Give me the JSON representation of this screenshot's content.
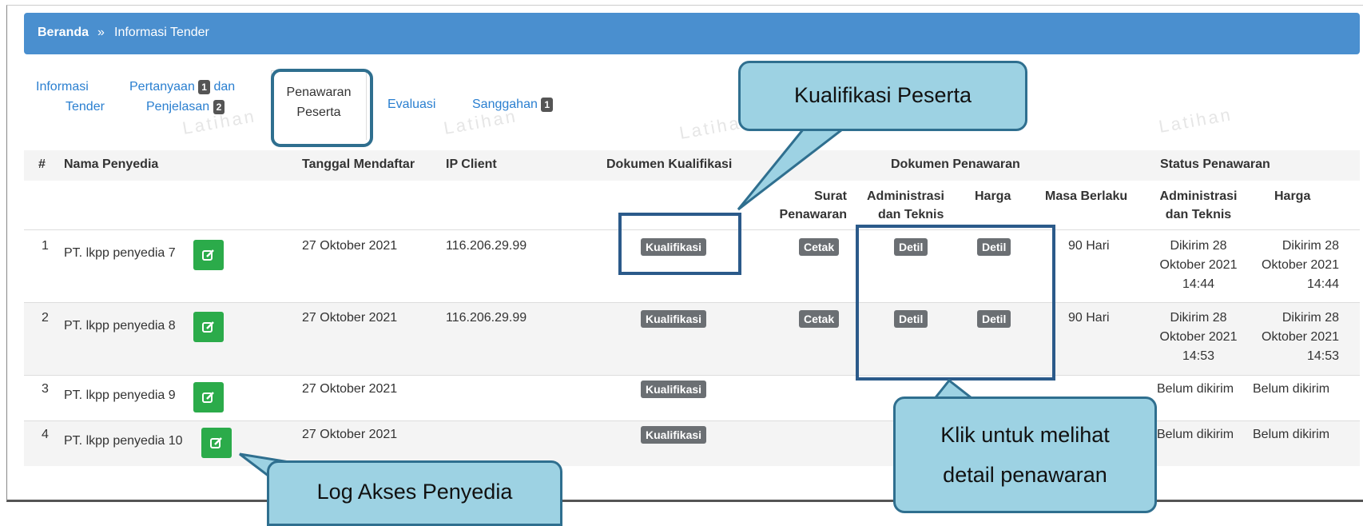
{
  "breadcrumb": {
    "home": "Beranda",
    "separator": "»",
    "current": "Informasi Tender"
  },
  "tabs": {
    "informasi": [
      "Informasi",
      "Tender"
    ],
    "pertanyaan": [
      "Pertanyaan",
      "dan",
      "Penjelasan"
    ],
    "pertanyaan_badges": [
      "1",
      "2"
    ],
    "penawaran": [
      "Penawaran",
      "Peserta"
    ],
    "evaluasi": "Evaluasi",
    "sanggahan": "Sanggahan",
    "sanggahan_badge": "1"
  },
  "watermark": "Latihan",
  "table": {
    "headers": {
      "no": "#",
      "nama": "Nama Penyedia",
      "tanggal": "Tanggal Mendaftar",
      "ip": "IP Client",
      "kualifikasi": "Dokumen Kualifikasi",
      "penawaran": "Dokumen Penawaran",
      "status": "Status Penawaran",
      "surat": [
        "Surat",
        "Penawaran"
      ],
      "admin": [
        "Administrasi",
        "dan Teknis"
      ],
      "harga": "Harga",
      "masa": "Masa Berlaku",
      "status_admin": [
        "Administrasi",
        "dan Teknis"
      ],
      "status_harga": "Harga"
    },
    "rows": [
      {
        "no": "1",
        "nama": "PT. lkpp penyedia 7",
        "tanggal": "27 Oktober 2021",
        "ip": "116.206.29.99",
        "kualifikasi": "Kualifikasi",
        "surat": "Cetak",
        "admin": "Detil",
        "harga": "Detil",
        "masa": "90 Hari",
        "status_admin": [
          "Dikirim 28",
          "Oktober 2021",
          "14:44"
        ],
        "status_harga": [
          "Dikirim 28",
          "Oktober 2021",
          "14:44"
        ]
      },
      {
        "no": "2",
        "nama": "PT. lkpp penyedia 8",
        "tanggal": "27 Oktober 2021",
        "ip": "116.206.29.99",
        "kualifikasi": "Kualifikasi",
        "surat": "Cetak",
        "admin": "Detil",
        "harga": "Detil",
        "masa": "90 Hari",
        "status_admin": [
          "Dikirim 28",
          "Oktober 2021",
          "14:53"
        ],
        "status_harga": [
          "Dikirim 28",
          "Oktober 2021",
          "14:53"
        ]
      },
      {
        "no": "3",
        "nama": "PT. lkpp penyedia 9",
        "tanggal": "27 Oktober 2021",
        "kualifikasi": "Kualifikasi",
        "status_admin": "Belum dikirim",
        "status_harga": "Belum dikirim"
      },
      {
        "no": "4",
        "nama": "PT. lkpp penyedia 10",
        "tanggal": "27 Oktober 2021",
        "kualifikasi": "Kualifikasi",
        "status_admin": "Belum dikirim",
        "status_harga": "Belum dikirim"
      }
    ]
  },
  "callouts": {
    "kualifikasi": "Kualifikasi Peserta",
    "detail": [
      "Klik untuk melihat",
      "detail penawaran"
    ],
    "log": "Log Akses Penyedia"
  },
  "colors": {
    "header": "#4a8fcf",
    "link": "#2a7fd0",
    "label": "#6b6f73",
    "edit": "#2bab4a",
    "callout": "#9dd2e3",
    "callout_border": "#2f6f8f",
    "highlight": "#2b5a8a"
  }
}
